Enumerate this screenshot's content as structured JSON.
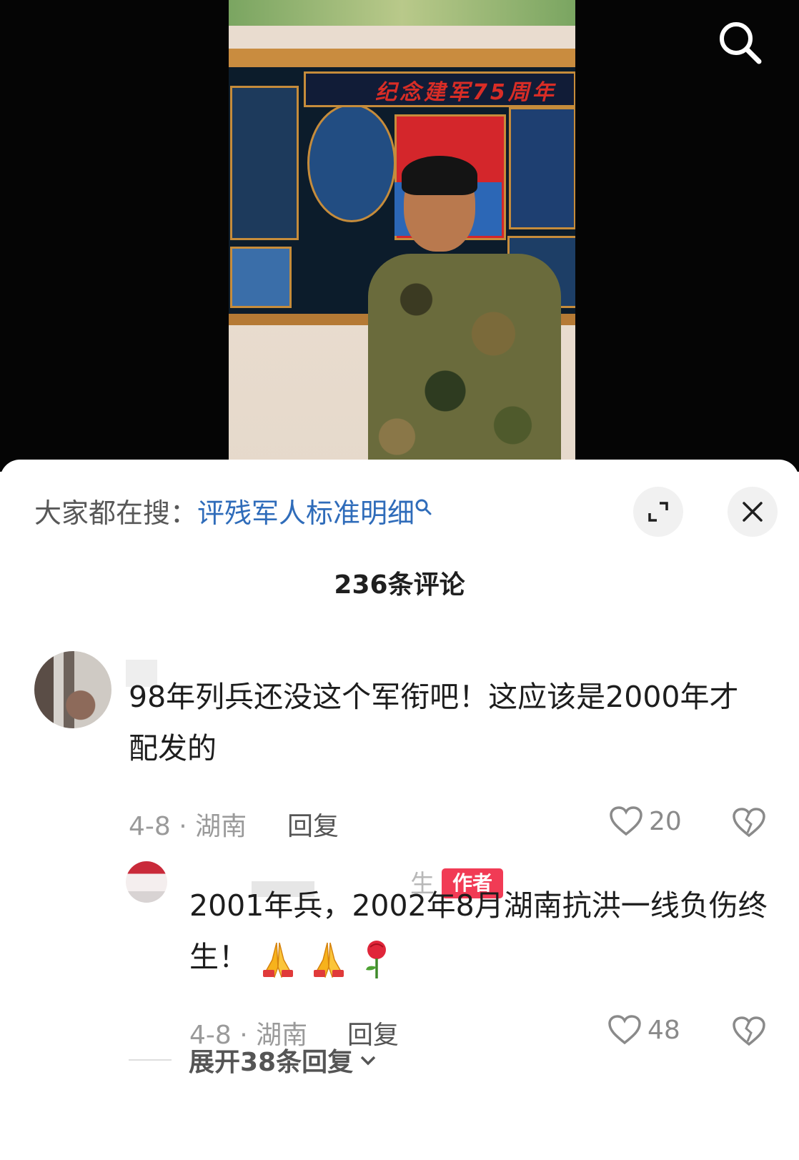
{
  "header": {
    "search_icon": "search-icon"
  },
  "video": {
    "board_title": "纪念建军75周年"
  },
  "sheet": {
    "hot_search_prefix": "大家都在搜：",
    "hot_search_term": "评残军人标准明细",
    "hot_search_icon": "search-icon",
    "expand_icon": "expand-icon",
    "close_icon": "close-icon",
    "comment_count": "236条评论"
  },
  "comments": [
    {
      "text": "98年列兵还没这个军衔吧！这应该是2000年才配发的",
      "date_location": "4-8 · 湖南",
      "reply_label": "回复",
      "likes": "20",
      "replies": [
        {
          "name_fragment": "生",
          "author_badge": "作者",
          "text": "2001年兵，2002年8月湖南抗洪一线负伤终生！",
          "emojis": [
            "folded-hands-icon",
            "folded-hands-icon",
            "rose-icon"
          ],
          "date_location": "4-8 · 湖南",
          "reply_label": "回复",
          "likes": "48"
        }
      ],
      "expand_replies_label": "展开38条回复"
    }
  ]
}
